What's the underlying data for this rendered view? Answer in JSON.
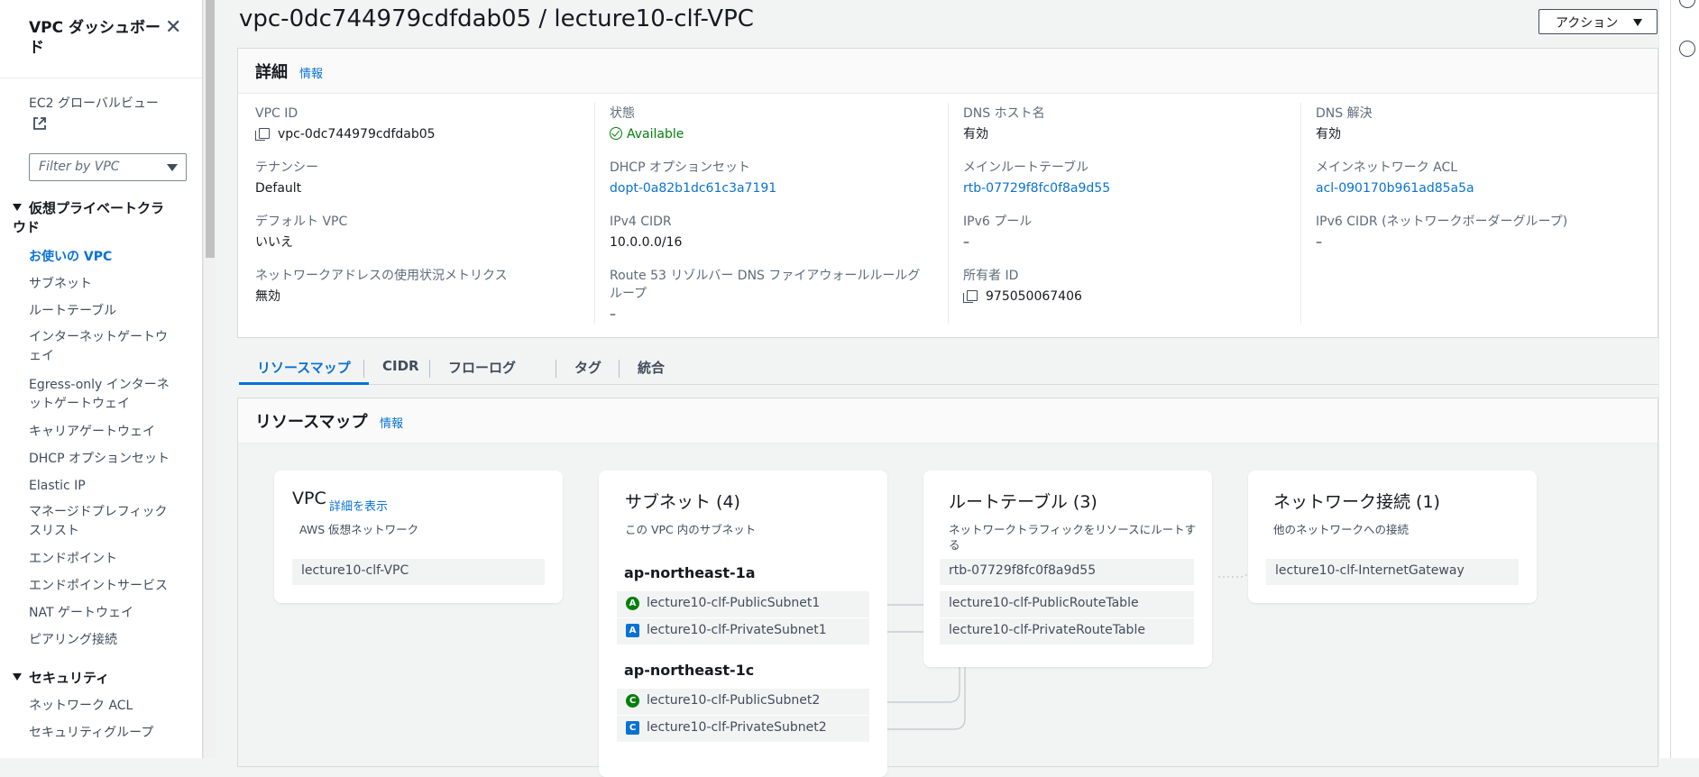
{
  "sidebar": {
    "title": "VPC ダッシュボード",
    "global_view": "EC2 グローバルビュー",
    "filter_placeholder": "Filter by VPC",
    "section_vpc": "仮想プライベートクラウド",
    "items": [
      "お使いの VPC",
      "サブネット",
      "ルートテーブル",
      "インターネットゲートウェイ",
      "Egress-only インターネットゲートウェイ",
      "キャリアゲートウェイ",
      "DHCP オプションセット",
      "Elastic IP",
      "マネージドプレフィックスリスト",
      "エンドポイント",
      "エンドポイントサービス",
      "NAT ゲートウェイ",
      "ピアリング接続"
    ],
    "section_security": "セキュリティ",
    "security_items": [
      "ネットワーク ACL",
      "セキュリティグループ"
    ]
  },
  "header": {
    "title": "vpc-0dc744979cdfdab05 / lecture10-clf-VPC",
    "action_label": "アクション"
  },
  "details": {
    "title": "詳細",
    "info": "情報",
    "col1": [
      {
        "k": "VPC ID",
        "v": "vpc-0dc744979cdfdab05"
      },
      {
        "k": "テナンシー",
        "v": "Default"
      },
      {
        "k": "デフォルト VPC",
        "v": "いいえ"
      },
      {
        "k": "ネットワークアドレスの使用状況メトリクス",
        "v": "無効"
      }
    ],
    "col2": [
      {
        "k": "状態",
        "v": "Available"
      },
      {
        "k": "DHCP オプションセット",
        "v": "dopt-0a82b1dc61c3a7191"
      },
      {
        "k": "IPv4 CIDR",
        "v": "10.0.0.0/16"
      },
      {
        "k": "Route 53 リゾルバー DNS ファイアウォールルールグループ",
        "v": "–"
      }
    ],
    "col3": [
      {
        "k": "DNS ホスト名",
        "v": "有効"
      },
      {
        "k": "メインルートテーブル",
        "v": "rtb-07729f8fc0f8a9d55"
      },
      {
        "k": "IPv6 プール",
        "v": "–"
      },
      {
        "k": "所有者 ID",
        "v": "975050067406"
      }
    ],
    "col4": [
      {
        "k": "DNS 解決",
        "v": "有効"
      },
      {
        "k": "メインネットワーク ACL",
        "v": "acl-090170b961ad85a5a"
      },
      {
        "k": "IPv6 CIDR (ネットワークボーダーグループ)",
        "v": "–"
      }
    ]
  },
  "tabs": [
    "リソースマップ",
    "CIDR",
    "フローログ",
    "タグ",
    "統合"
  ],
  "resource_map": {
    "title": "リソースマップ",
    "info": "情報",
    "vpc": {
      "title": "VPC",
      "link": "詳細を表示",
      "sub": "AWS 仮想ネットワーク",
      "chip": "lecture10-clf-VPC"
    },
    "subnets": {
      "title": "サブネット (4)",
      "sub": "この VPC 内のサブネット",
      "az1": "ap-northeast-1a",
      "az2": "ap-northeast-1c",
      "items": [
        {
          "badge": "A",
          "name": "lecture10-clf-PublicSubnet1"
        },
        {
          "badge": "A",
          "name": "lecture10-clf-PrivateSubnet1"
        },
        {
          "badge": "C",
          "name": "lecture10-clf-PublicSubnet2"
        },
        {
          "badge": "C",
          "name": "lecture10-clf-PrivateSubnet2"
        }
      ]
    },
    "routes": {
      "title": "ルートテーブル (3)",
      "sub": "ネットワークトラフィックをリソースにルートする",
      "items": [
        "rtb-07729f8fc0f8a9d55",
        "lecture10-clf-PublicRouteTable",
        "lecture10-clf-PrivateRouteTable"
      ]
    },
    "network": {
      "title": "ネットワーク接続 (1)",
      "sub": "他のネットワークへの接続",
      "items": [
        "lecture10-clf-InternetGateway"
      ]
    }
  }
}
